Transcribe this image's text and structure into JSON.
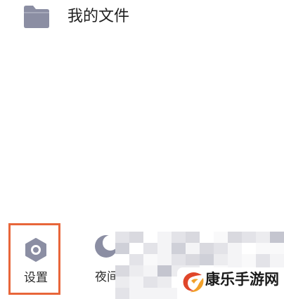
{
  "menu": {
    "my_files": {
      "icon": "folder-icon",
      "label": "我的文件"
    }
  },
  "bottom_bar": {
    "settings": {
      "icon": "settings-hex-icon",
      "label": "设置",
      "highlight_color": "#e8663a"
    },
    "night_mode": {
      "icon": "moon-icon",
      "label": "夜间"
    }
  },
  "watermark": {
    "text": "康乐手游网",
    "logo": "watermark-logo-icon"
  },
  "colors": {
    "icon_gray": "#8b8ea3",
    "text": "#1f1f1f",
    "highlight": "#e8663a"
  }
}
